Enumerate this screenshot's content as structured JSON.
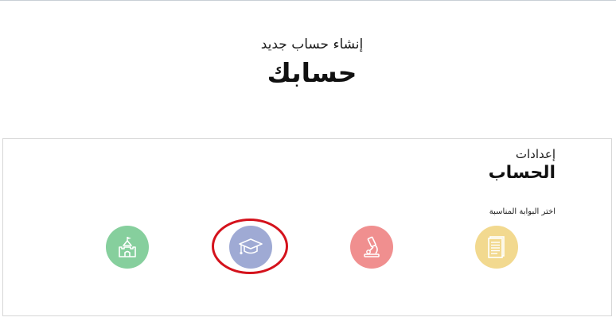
{
  "header": {
    "subtitle": "إنشاء حساب جديد",
    "title": "حسابك"
  },
  "card": {
    "subtitle": "إعدادات",
    "title": "الحساب",
    "hint": "اختر البوابة المناسبة"
  },
  "portals": [
    {
      "icon": "document-icon",
      "color": "#f2d98f"
    },
    {
      "icon": "microscope-icon",
      "color": "#f08f8f"
    },
    {
      "icon": "graduation-cap-icon",
      "color": "#9faad4",
      "highlighted": true,
      "highlight_color": "#d4121c"
    },
    {
      "icon": "castle-icon",
      "color": "#86cf9d"
    }
  ]
}
